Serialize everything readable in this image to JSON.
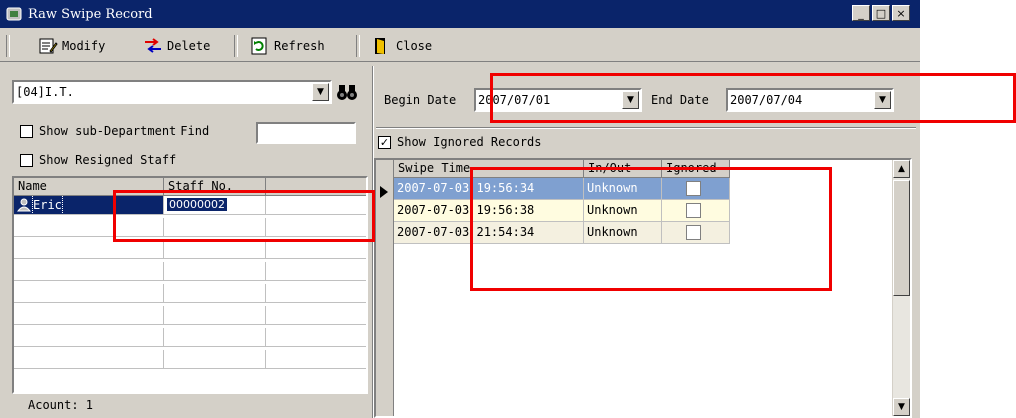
{
  "window": {
    "title": "Raw Swipe Record",
    "controls": [
      "_",
      "□",
      "×"
    ]
  },
  "toolbar": {
    "modify": "Modify",
    "delete": "Delete",
    "refresh": "Refresh",
    "close": "Close"
  },
  "left": {
    "department": "[04]I.T.",
    "show_sub_department": "Show sub-Department",
    "find_label": "Find",
    "find_value": "",
    "show_resigned": "Show Resigned Staff",
    "columns": [
      "Name",
      "Staff No."
    ],
    "staff": [
      {
        "name": "Eric",
        "staff_no": "00000002",
        "selected": true
      }
    ],
    "count_text": "Acount: 1"
  },
  "right": {
    "begin_date_label": "Begin Date",
    "begin_date": "2007/07/01",
    "end_date_label": "End Date",
    "end_date": "2007/07/04",
    "show_ignored_label": "Show Ignored Records",
    "show_ignored_checked": true,
    "columns": [
      "Swipe Time",
      "In/Out",
      "Ignored"
    ],
    "records": [
      {
        "time": "2007-07-03 19:56:34",
        "inout": "Unknown",
        "ignored": false,
        "selected": true
      },
      {
        "time": "2007-07-03 19:56:38",
        "inout": "Unknown",
        "ignored": false,
        "selected": false
      },
      {
        "time": "2007-07-03 21:54:34",
        "inout": "Unknown",
        "ignored": false,
        "selected": false
      }
    ]
  },
  "colors": {
    "title_bg": "#0a246a",
    "selection": "#0a246a",
    "record_selected": "#7fa0d0",
    "row_tint": "#fffce0",
    "annotation": "#f00000"
  }
}
